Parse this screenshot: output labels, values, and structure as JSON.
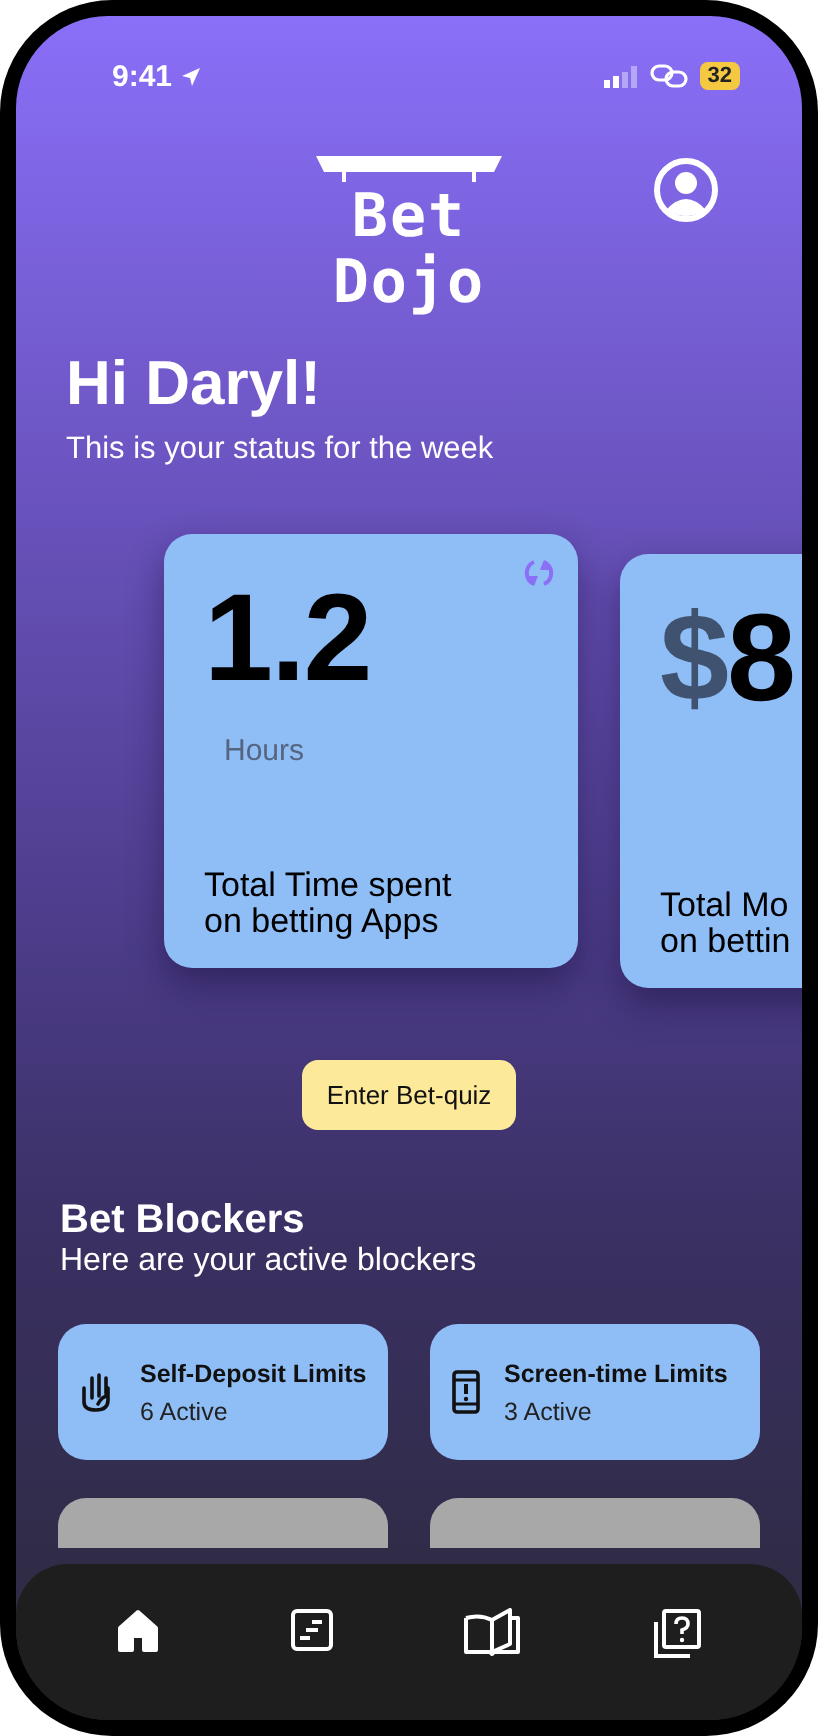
{
  "status_bar": {
    "time": "9:41",
    "battery": "32"
  },
  "header": {
    "logo_line_1": "Bet",
    "logo_line_2": "Dojo"
  },
  "greeting": {
    "title": "Hi Daryl!",
    "subtitle": "This is your status for the week"
  },
  "stat_cards": [
    {
      "value": "1.2",
      "unit": "Hours",
      "label_lines": [
        "Total Time spent",
        "on betting Apps"
      ]
    },
    {
      "value_prefix": "$",
      "value": "8",
      "label_lines": [
        "Total Mo",
        "on bettin"
      ]
    }
  ],
  "quiz_button": {
    "label": "Enter Bet-quiz"
  },
  "blockers_section": {
    "title": "Bet Blockers",
    "subtitle": "Here are your active blockers"
  },
  "blockers": [
    {
      "name": "Self-Deposit Limits",
      "count": "6 Active",
      "active": true
    },
    {
      "name": "Screen-time Limits",
      "count": "3 Active",
      "active": true
    },
    {
      "active": false
    },
    {
      "active": false
    }
  ],
  "bottom_nav": [
    {
      "selected": true
    },
    {
      "selected": false
    },
    {
      "selected": false
    },
    {
      "selected": false
    }
  ]
}
